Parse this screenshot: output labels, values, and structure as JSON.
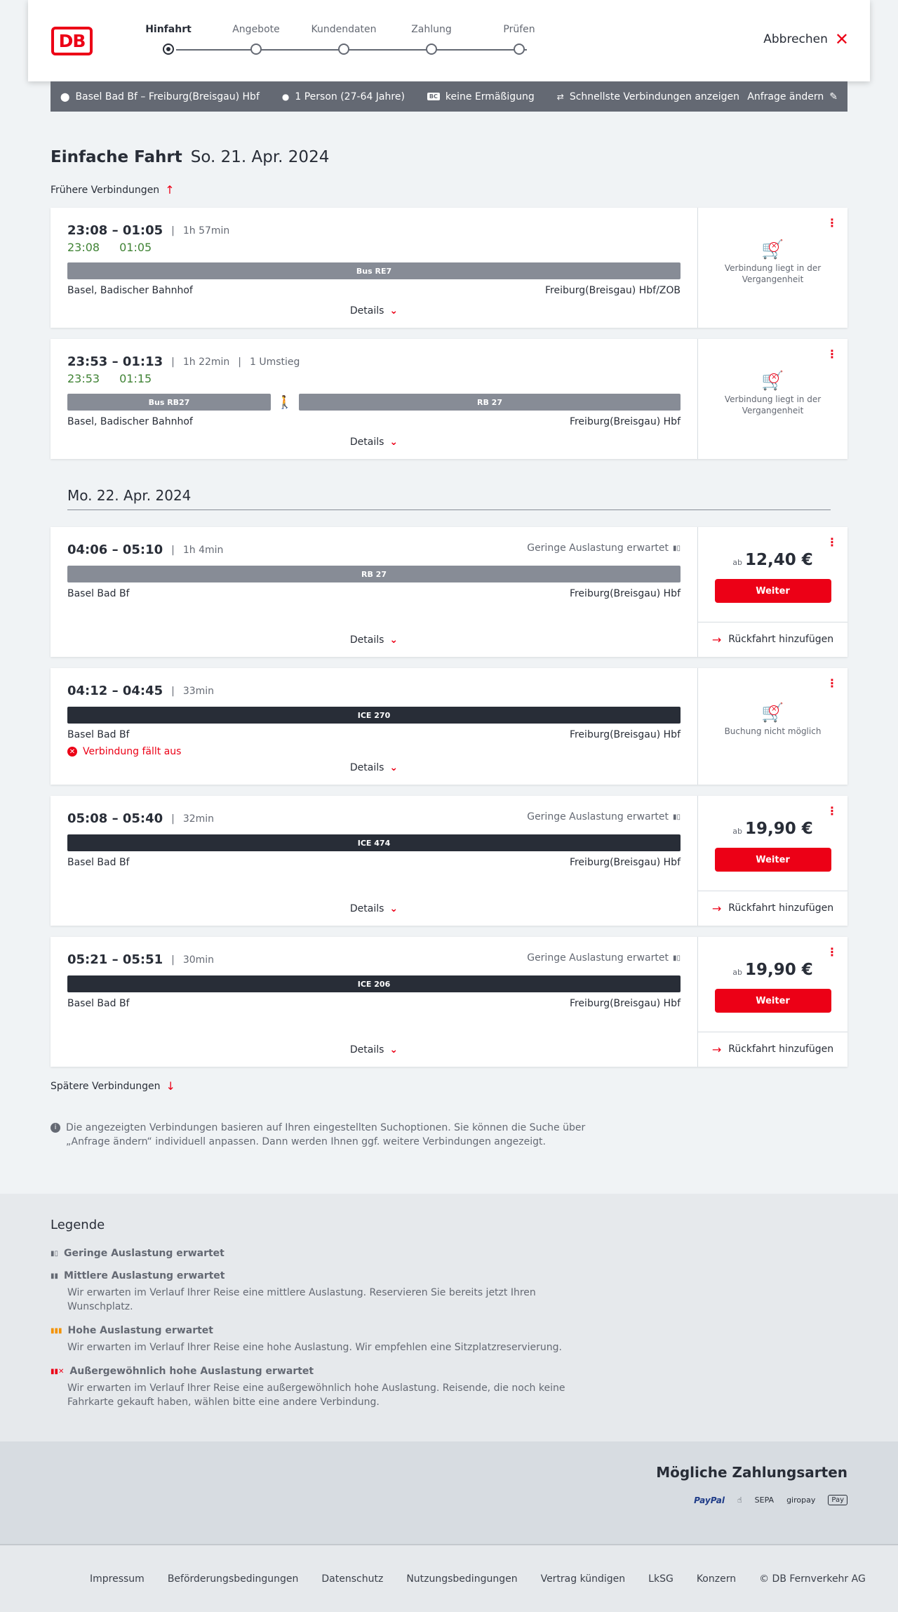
{
  "header": {
    "logo": "DB",
    "steps": [
      "Hinfahrt",
      "Angebote",
      "Kundendaten",
      "Zahlung",
      "Prüfen"
    ],
    "cancel": "Abbrechen"
  },
  "summary": {
    "route": "Basel Bad Bf – Freiburg(Breisgau) Hbf",
    "passengers": "1 Person (27-64 Jahre)",
    "bc_badge": "BC",
    "discount": "keine Ermäßigung",
    "fastest": "Schnellste Verbindungen anzeigen",
    "change": "Anfrage ändern"
  },
  "trip": {
    "title": "Einfache Fahrt",
    "date": "So. 21. Apr. 2024"
  },
  "earlier": "Frühere Verbindungen",
  "later": "Spätere Verbindungen",
  "details_label": "Details",
  "weiter_label": "Weiter",
  "rueck_label": "Rückfahrt hinzufügen",
  "ab_label": "ab",
  "past_label": "Verbindung liegt in der Vergangenheit",
  "notbook_label": "Buchung nicht möglich",
  "day2": "Mo. 22. Apr. 2024",
  "connections": [
    {
      "times": "23:08 – 01:05",
      "duration": "1h 57min",
      "transfers": "",
      "rt_dep": "23:08",
      "rt_arr": "01:05",
      "segments": [
        {
          "label": "Bus RE7",
          "style": "grey"
        }
      ],
      "from": "Basel, Badischer Bahnhof",
      "to": "Freiburg(Breisgau) Hbf/ZOB"
    },
    {
      "times": "23:53 – 01:13",
      "duration": "1h 22min",
      "transfers": "1 Umstieg",
      "rt_dep": "23:53",
      "rt_arr": "01:15",
      "segments": [
        {
          "label": "Bus RB27",
          "style": "grey"
        },
        {
          "label": "RB 27",
          "style": "grey"
        }
      ],
      "from": "Basel, Badischer Bahnhof",
      "to": "Freiburg(Breisgau) Hbf"
    },
    {
      "times": "04:06 – 05:10",
      "duration": "1h 4min",
      "load": "Geringe Auslastung erwartet",
      "segments": [
        {
          "label": "RB 27",
          "style": "grey"
        }
      ],
      "from": "Basel Bad Bf",
      "to": "Freiburg(Breisgau) Hbf",
      "price": "12,40 €"
    },
    {
      "times": "04:12 – 04:45",
      "duration": "33min",
      "segments": [
        {
          "label": "ICE 270",
          "style": "dark"
        }
      ],
      "from": "Basel Bad Bf",
      "to": "Freiburg(Breisgau) Hbf",
      "cancelled": "Verbindung fällt aus"
    },
    {
      "times": "05:08 – 05:40",
      "duration": "32min",
      "load": "Geringe Auslastung erwartet",
      "segments": [
        {
          "label": "ICE 474",
          "style": "dark"
        }
      ],
      "from": "Basel Bad Bf",
      "to": "Freiburg(Breisgau) Hbf",
      "price": "19,90 €"
    },
    {
      "times": "05:21 – 05:51",
      "duration": "30min",
      "load": "Geringe Auslastung erwartet",
      "segments": [
        {
          "label": "ICE 206",
          "style": "dark"
        }
      ],
      "from": "Basel Bad Bf",
      "to": "Freiburg(Breisgau) Hbf",
      "price": "19,90 €"
    }
  ],
  "info": "Die angezeigten Verbindungen basieren auf Ihren eingestellten Suchoptionen. Sie können die Suche über „Anfrage ändern“ individuell anpassen. Dann werden Ihnen ggf. weitere Verbindungen angezeigt.",
  "legend": {
    "title": "Legende",
    "items": [
      {
        "title": "Geringe Auslastung erwartet",
        "desc": ""
      },
      {
        "title": "Mittlere Auslastung erwartet",
        "desc": "Wir erwarten im Verlauf Ihrer Reise eine mittlere Auslastung. Reservieren Sie bereits jetzt Ihren Wunschplatz."
      },
      {
        "title": "Hohe Auslastung erwartet",
        "desc": "Wir erwarten im Verlauf Ihrer Reise eine hohe Auslastung. Wir empfehlen eine Sitzplatzreservierung."
      },
      {
        "title": "Außergewöhnlich hohe Auslastung erwartet",
        "desc": "Wir erwarten im Verlauf Ihrer Reise eine außergewöhnlich hohe Auslastung. Reisende, die noch keine Fahrkarte gekauft haben, wählen bitte eine andere Verbindung."
      }
    ]
  },
  "payment": {
    "title": "Mögliche Zahlungsarten",
    "methods": [
      "PayPal",
      "SEPA",
      "giropay",
      "Pay"
    ]
  },
  "footer": [
    "Impressum",
    "Beförderungsbedingungen",
    "Datenschutz",
    "Nutzungsbedingungen",
    "Vertrag kündigen",
    "LkSG",
    "Konzern",
    "© DB Fernverkehr AG"
  ],
  "colors": {
    "db_red": "#ec0016",
    "realtime_green": "#408335",
    "summary_bar": "#646973"
  }
}
